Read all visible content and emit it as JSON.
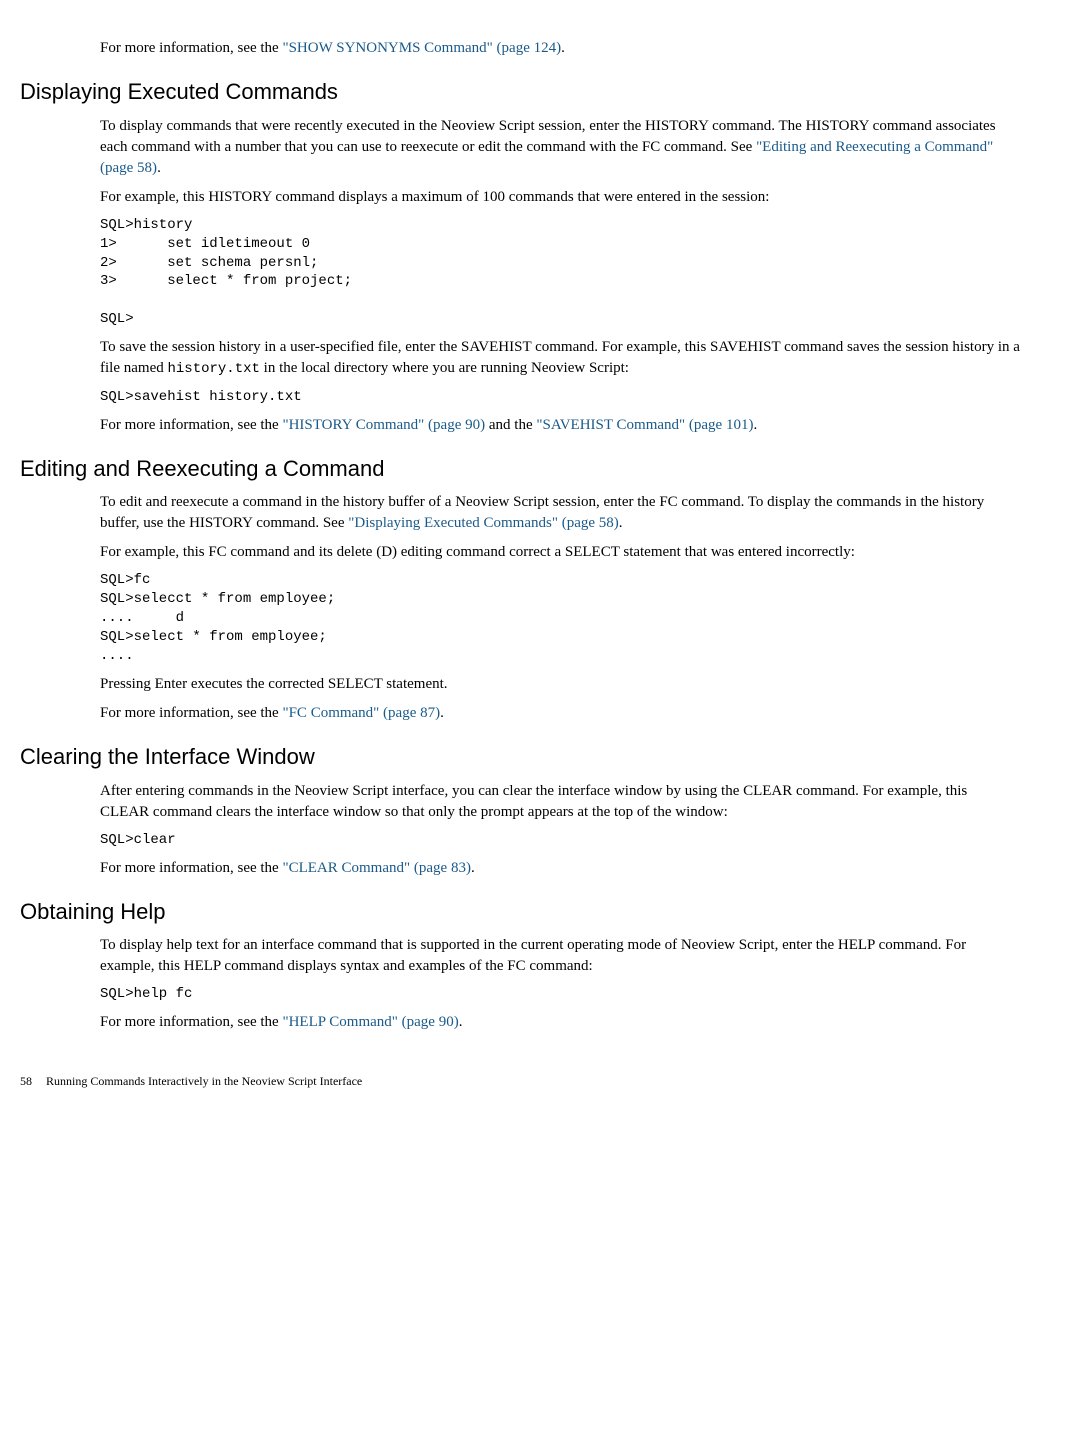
{
  "intro_para": {
    "pre": "For more information, see the ",
    "link": "\"SHOW SYNONYMS Command\" (page 124)",
    "post": "."
  },
  "sec1": {
    "heading": "Displaying Executed Commands",
    "p1_pre": "To display commands that were recently executed in the Neoview Script session, enter the HISTORY command. The HISTORY command associates each command with a number that you can use to reexecute or edit the command with the FC command. See ",
    "p1_link": "\"Editing and Reexecuting a Command\" (page 58)",
    "p1_post": ".",
    "p2": "For example, this HISTORY command displays a maximum of 100 commands that were entered in the session:",
    "code1": "SQL>history\n1>      set idletimeout 0\n2>      set schema persnl;\n3>      select * from project;\n\nSQL>",
    "p3_pre": "To save the session history in a user-specified file, enter the SAVEHIST command. For example, this SAVEHIST command saves the session history in a file named ",
    "p3_code": "history.txt",
    "p3_post": " in the local directory where you are running Neoview Script:",
    "code2": "SQL>savehist history.txt",
    "p4_pre": "For more information, see the ",
    "p4_link1": "\"HISTORY Command\" (page 90)",
    "p4_mid": " and the ",
    "p4_link2": "\"SAVEHIST Command\" (page 101)",
    "p4_post": "."
  },
  "sec2": {
    "heading": "Editing and Reexecuting a Command",
    "p1_pre": "To edit and reexecute a command in the history buffer of a Neoview Script session, enter the FC command. To display the commands in the history buffer, use the HISTORY command. See ",
    "p1_link": "\"Displaying Executed Commands\" (page 58)",
    "p1_post": ".",
    "p2": "For example, this FC command and its delete (D) editing command correct a SELECT statement that was entered incorrectly:",
    "code1": "SQL>fc\nSQL>selecct * from employee;\n....     d\nSQL>select * from employee;\n....",
    "p3": "Pressing Enter executes the corrected SELECT statement.",
    "p4_pre": "For more information, see the ",
    "p4_link": "\"FC Command\" (page 87)",
    "p4_post": "."
  },
  "sec3": {
    "heading": "Clearing the Interface Window",
    "p1": "After entering commands in the Neoview Script interface, you can clear the interface window by using the CLEAR command. For example, this CLEAR command clears the interface window so that only the prompt appears at the top of the window:",
    "code1": "SQL>clear",
    "p2_pre": "For more information, see the ",
    "p2_link": "\"CLEAR Command\" (page 83)",
    "p2_post": "."
  },
  "sec4": {
    "heading": "Obtaining Help",
    "p1": "To display help text for an interface command that is supported in the current operating mode of Neoview Script, enter the HELP command. For example, this HELP command displays syntax and examples of the FC command:",
    "code1": "SQL>help fc",
    "p2_pre": "For more information, see the ",
    "p2_link": "\"HELP Command\" (page 90)",
    "p2_post": "."
  },
  "footer": {
    "page": "58",
    "title": "Running Commands Interactively in the Neoview Script Interface"
  }
}
